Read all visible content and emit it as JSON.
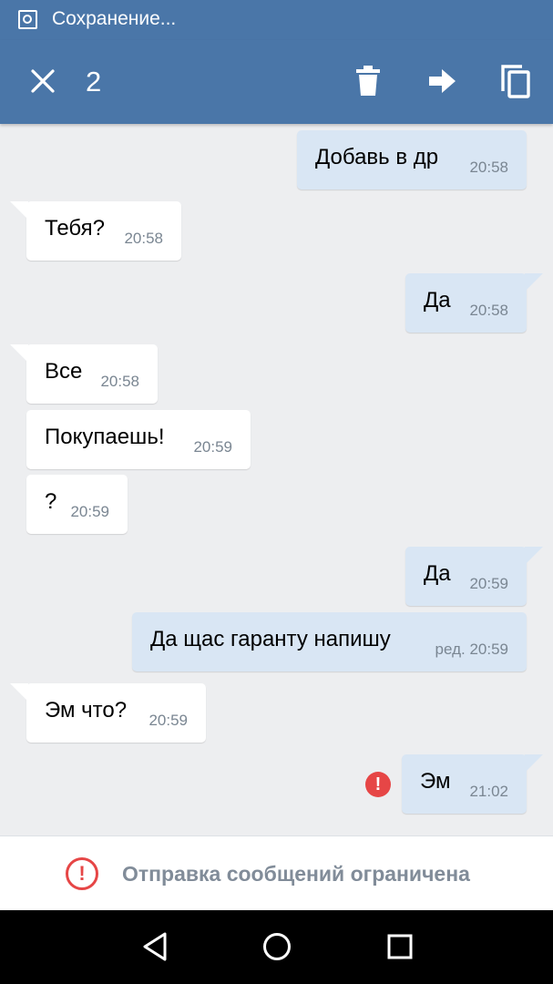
{
  "status_bar": {
    "text": "Сохранение...",
    "icon": "image-save-icon"
  },
  "app_bar": {
    "selected_count": "2",
    "close_icon": "close-icon",
    "delete_icon": "trash-icon",
    "forward_icon": "forward-arrow-icon",
    "copy_icon": "copy-icon",
    "color": "#4a76a8"
  },
  "messages": [
    {
      "dir": "out",
      "text": "Добавь в др",
      "time": "20:58"
    },
    {
      "dir": "in",
      "text": "Тебя?",
      "time": "20:58"
    },
    {
      "dir": "out",
      "text": "Да",
      "time": "20:58"
    },
    {
      "dir": "in",
      "text": "Все",
      "time": "20:58"
    },
    {
      "dir": "in",
      "text": "Покупаешь!",
      "time": "20:59"
    },
    {
      "dir": "in",
      "text": "?",
      "time": "20:59"
    },
    {
      "dir": "out",
      "text": "Да",
      "time": "20:59"
    },
    {
      "dir": "out",
      "text": "Да щас гаранту напишу",
      "time": "ред. 20:59"
    },
    {
      "dir": "in",
      "text": "Эм что?",
      "time": "20:59"
    },
    {
      "dir": "out",
      "text": "Эм",
      "time": "21:02",
      "error": true
    }
  ],
  "error_mark": "!",
  "restriction": {
    "icon": "alert-circle-icon",
    "mark": "!",
    "text": "Отправка сообщений ограничена",
    "color": "#e64646"
  },
  "nav_bar": {
    "back_icon": "back-triangle-icon",
    "home_icon": "home-circle-icon",
    "recents_icon": "recents-square-icon"
  },
  "colors": {
    "incoming_bubble": "#ffffff",
    "outgoing_bubble": "#d9e6f4",
    "background": "#edeef0"
  }
}
